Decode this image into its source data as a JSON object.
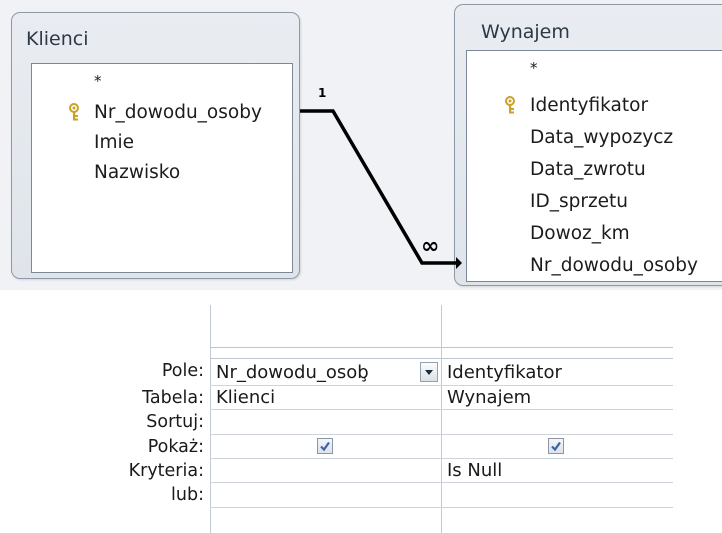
{
  "relationship_pane": {
    "left_table": {
      "title": "Klienci",
      "fields": [
        "*",
        "Nr_dowodu_osoby",
        "Imie",
        "Nazwisko"
      ],
      "primary_key_field": "Nr_dowodu_osoby"
    },
    "right_table": {
      "title": "Wynajem",
      "fields": [
        "*",
        "Identyfikator",
        "Data_wypozycz",
        "Data_zwrotu",
        "ID_sprzetu",
        "Dowoz_km",
        "Nr_dowodu_osoby"
      ],
      "primary_key_field": "Identyfikator"
    },
    "relation": {
      "one_label": "1",
      "many_label": "∞"
    }
  },
  "query_grid": {
    "row_labels": [
      "Pole:",
      "Tabela:",
      "Sortuj:",
      "Pokaż:",
      "Kryteria:",
      "lub:"
    ],
    "columns": [
      {
        "field": "Nr_dowodu_osob̧",
        "table": "Klienci",
        "sort": "",
        "show": true,
        "criteria": "",
        "or": "",
        "has_dropdown": true
      },
      {
        "field": "Identyfikator",
        "table": "Wynajem",
        "sort": "",
        "show": true,
        "criteria": "Is Null",
        "or": "",
        "has_dropdown": false
      }
    ]
  },
  "colors": {
    "pane_background": "#f0f2f5",
    "window_border": "#8e99a8",
    "grid_border": "#c3c9d1",
    "key_icon": "#c9a227",
    "checkmark": "#3a64a8"
  }
}
